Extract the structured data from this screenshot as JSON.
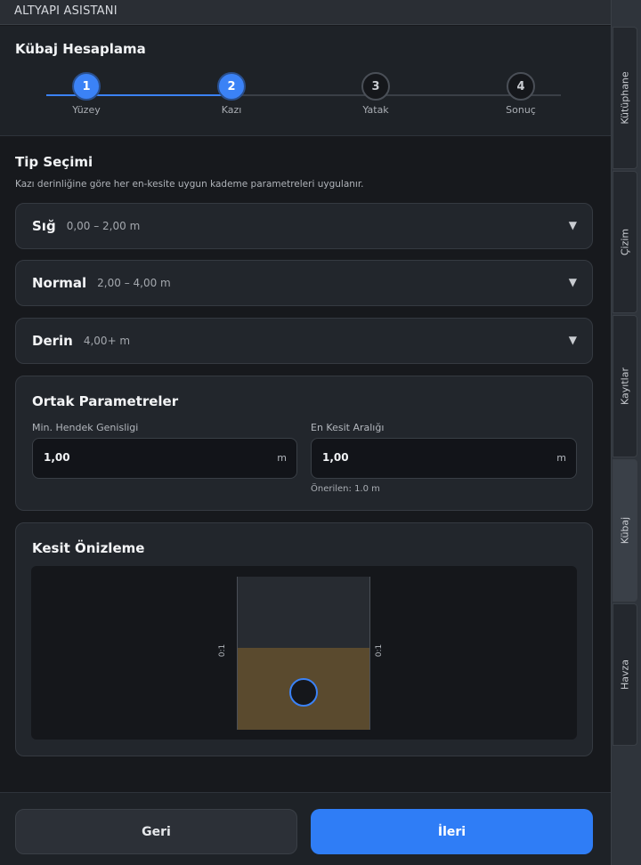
{
  "app": {
    "title": "ALTYAPI ASISTANI"
  },
  "header": {
    "title": "Kübaj Hesaplama",
    "steps": [
      {
        "number": "1",
        "label": "Yüzey",
        "state": "active"
      },
      {
        "number": "2",
        "label": "Kazı",
        "state": "active"
      },
      {
        "number": "3",
        "label": "Yatak",
        "state": "inactive"
      },
      {
        "number": "4",
        "label": "Sonuç",
        "state": "inactive"
      }
    ]
  },
  "type_selection": {
    "title": "Tip Seçimi",
    "description": "Kazı derinliğine göre her en-kesite uygun kademe parametreleri uygulanır.",
    "items": [
      {
        "name": "Sığ",
        "range": "0,00 – 2,00 m"
      },
      {
        "name": "Normal",
        "range": "2,00 – 4,00 m"
      },
      {
        "name": "Derin",
        "range": "4,00+ m"
      }
    ],
    "arrow_glyph": "▼"
  },
  "common_params": {
    "title": "Ortak Parametreler",
    "min_width": {
      "label": "Min. Hendek Genisligi",
      "value": "1,00",
      "unit": "m"
    },
    "section_interval": {
      "label": "En Kesit Aralığı",
      "value": "1,00",
      "unit": "m",
      "hint": "Önerilen: 1.0 m"
    }
  },
  "preview": {
    "title": "Kesit Önizleme",
    "slope_left": "0:1",
    "slope_right": "0:1",
    "colors": {
      "soil": "#5a4a2e",
      "pipe_stroke": "#3b82f6"
    }
  },
  "footer": {
    "back_label": "Geri",
    "next_label": "İleri",
    "accent": "#2f7df6"
  },
  "sidebar": {
    "tabs": [
      {
        "label": "Kütüphane",
        "active": false
      },
      {
        "label": "Çizim",
        "active": false
      },
      {
        "label": "Kayıtlar",
        "active": false
      },
      {
        "label": "Kübaj",
        "active": true
      },
      {
        "label": "Havza",
        "active": false
      }
    ]
  }
}
